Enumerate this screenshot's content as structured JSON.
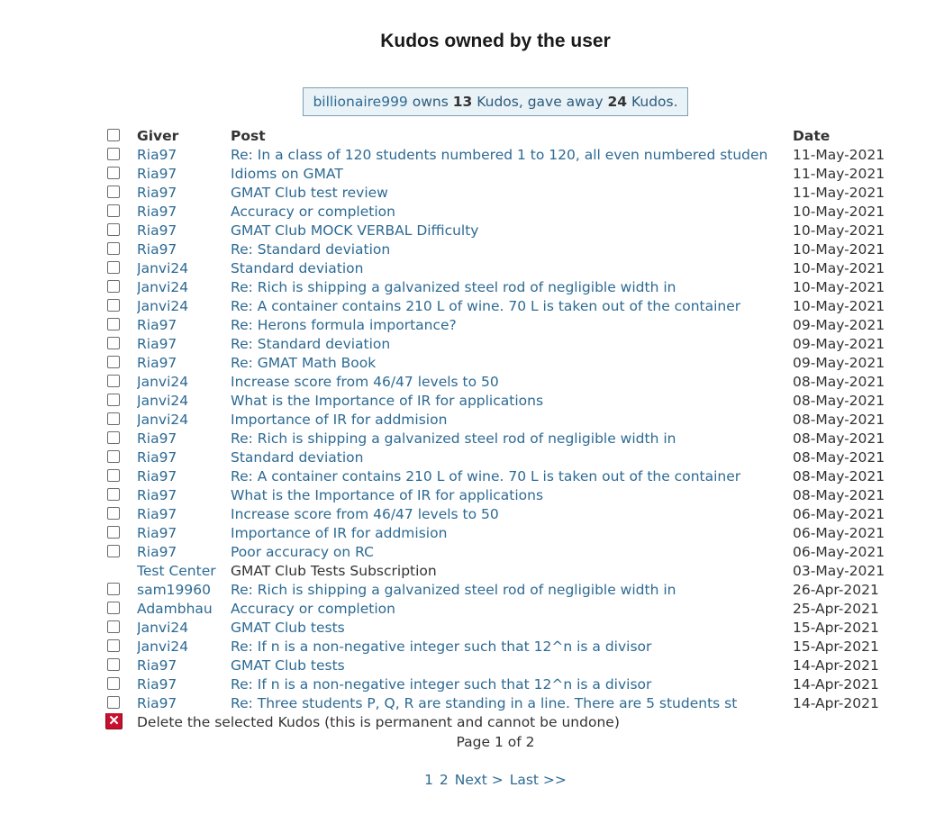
{
  "page_title": "Kudos owned by the user",
  "summary": {
    "user": "billionaire999",
    "owns_prefix": " owns ",
    "owned_count": "13",
    "gave_prefix": " Kudos, gave away ",
    "given_count": "24",
    "suffix": " Kudos."
  },
  "table": {
    "headers": {
      "giver": "Giver",
      "post": "Post",
      "date": "Date"
    },
    "rows": [
      {
        "checkbox": true,
        "giver": "Ria97",
        "post": "Re: In a class of 120 students numbered 1 to 120, all even numbered studen",
        "date": "11-May-2021"
      },
      {
        "checkbox": true,
        "giver": "Ria97",
        "post": "Idioms on GMAT",
        "date": "11-May-2021"
      },
      {
        "checkbox": true,
        "giver": "Ria97",
        "post": "GMAT Club test review",
        "date": "11-May-2021"
      },
      {
        "checkbox": true,
        "giver": "Ria97",
        "post": "Accuracy or completion",
        "date": "10-May-2021"
      },
      {
        "checkbox": true,
        "giver": "Ria97",
        "post": "GMAT Club MOCK VERBAL Difficulty",
        "date": "10-May-2021"
      },
      {
        "checkbox": true,
        "giver": "Ria97",
        "post": "Re: Standard deviation",
        "date": "10-May-2021"
      },
      {
        "checkbox": true,
        "giver": "Janvi24",
        "post": "Standard deviation",
        "date": "10-May-2021"
      },
      {
        "checkbox": true,
        "giver": "Janvi24",
        "post": "Re: Rich is shipping a galvanized steel rod of negligible width in",
        "date": "10-May-2021"
      },
      {
        "checkbox": true,
        "giver": "Janvi24",
        "post": "Re: A container contains 210 L of wine. 70 L is taken out of the container",
        "date": "10-May-2021"
      },
      {
        "checkbox": true,
        "giver": "Ria97",
        "post": "Re: Herons formula importance?",
        "date": "09-May-2021"
      },
      {
        "checkbox": true,
        "giver": "Ria97",
        "post": "Re: Standard deviation",
        "date": "09-May-2021"
      },
      {
        "checkbox": true,
        "giver": "Ria97",
        "post": "Re: GMAT Math Book",
        "date": "09-May-2021"
      },
      {
        "checkbox": true,
        "giver": "Janvi24",
        "post": "Increase score from 46/47 levels to 50",
        "date": "08-May-2021"
      },
      {
        "checkbox": true,
        "giver": "Janvi24",
        "post": "What is the Importance of IR for applications",
        "date": "08-May-2021"
      },
      {
        "checkbox": true,
        "giver": "Janvi24",
        "post": "Importance of IR for addmision",
        "date": "08-May-2021"
      },
      {
        "checkbox": true,
        "giver": "Ria97",
        "post": "Re: Rich is shipping a galvanized steel rod of negligible width in",
        "date": "08-May-2021"
      },
      {
        "checkbox": true,
        "giver": "Ria97",
        "post": "Standard deviation",
        "date": "08-May-2021"
      },
      {
        "checkbox": true,
        "giver": "Ria97",
        "post": "Re: A container contains 210 L of wine. 70 L is taken out of the container",
        "date": "08-May-2021"
      },
      {
        "checkbox": true,
        "giver": "Ria97",
        "post": "What is the Importance of IR for applications",
        "date": "08-May-2021"
      },
      {
        "checkbox": true,
        "giver": "Ria97",
        "post": "Increase score from 46/47 levels to 50",
        "date": "06-May-2021"
      },
      {
        "checkbox": true,
        "giver": "Ria97",
        "post": "Importance of IR for addmision",
        "date": "06-May-2021"
      },
      {
        "checkbox": true,
        "giver": "Ria97",
        "post": "Poor accuracy on RC",
        "date": "06-May-2021"
      },
      {
        "checkbox": false,
        "giver": "Test Center",
        "post": "GMAT Club Tests Subscription",
        "date": "03-May-2021"
      },
      {
        "checkbox": true,
        "giver": "sam19960",
        "post": "Re: Rich is shipping a galvanized steel rod of negligible width in",
        "date": "26-Apr-2021"
      },
      {
        "checkbox": true,
        "giver": "Adambhau",
        "post": "Accuracy or completion",
        "date": "25-Apr-2021"
      },
      {
        "checkbox": true,
        "giver": "Janvi24",
        "post": "GMAT Club tests",
        "date": "15-Apr-2021"
      },
      {
        "checkbox": true,
        "giver": "Janvi24",
        "post": "Re: If n is a non-negative integer such that 12^n is a divisor",
        "date": "15-Apr-2021"
      },
      {
        "checkbox": true,
        "giver": "Ria97",
        "post": "GMAT Club tests",
        "date": "14-Apr-2021"
      },
      {
        "checkbox": true,
        "giver": "Ria97",
        "post": "Re: If n is a non-negative integer such that 12^n is a divisor",
        "date": "14-Apr-2021"
      },
      {
        "checkbox": true,
        "giver": "Ria97",
        "post": "Re: Three students P, Q, R are standing in a line. There are 5 students st",
        "date": "14-Apr-2021"
      }
    ],
    "delete_label": "Delete the selected Kudos (this is permanent and cannot be undone)"
  },
  "pagination": {
    "page_info": "Page 1 of 2",
    "page_1": "1",
    "page_2": "2",
    "next": "Next >",
    "last": "Last >>"
  },
  "colors": {
    "link": "#2d6a93",
    "summary_bg": "#e9f2f7",
    "summary_border": "#7d9fb0",
    "delete_icon": "#c8102e"
  },
  "icons": {
    "delete": "delete-x-icon",
    "checkbox": "checkbox"
  }
}
